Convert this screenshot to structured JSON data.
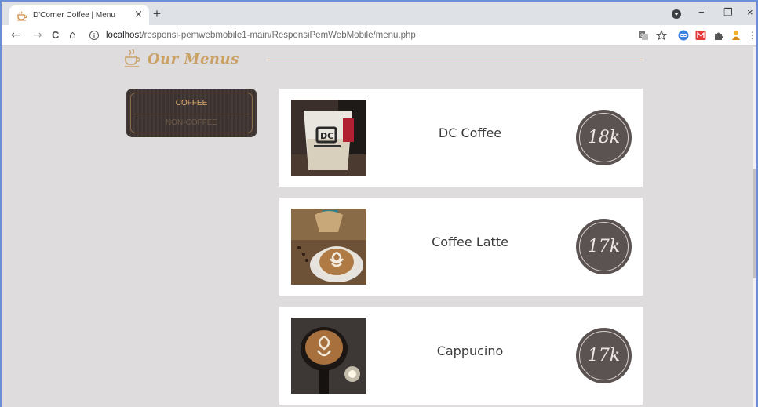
{
  "browser": {
    "tab_title": "D'Corner Coffee | Menu",
    "tab_close": "×",
    "new_tab": "+",
    "url_host": "localhost",
    "url_path": "/responsi-pemwebmobile1-main/ResponsiPemWebMobile/menu.php",
    "window_controls": {
      "minimize": "−",
      "restore": "❐",
      "close": "×"
    },
    "nav": {
      "back": "←",
      "forward": "→",
      "reload": "C",
      "home": "⌂"
    }
  },
  "page": {
    "heading": "Our Menus",
    "categories": [
      {
        "label": "COFFEE",
        "active": true
      },
      {
        "label": "NON-COFFEE",
        "active": false
      }
    ],
    "menu_items": [
      {
        "name": "DC Coffee",
        "price": "18k",
        "image": "dc-coffee-cup-photo"
      },
      {
        "name": "Coffee Latte",
        "price": "17k",
        "image": "coffee-latte-art-photo"
      },
      {
        "name": "Cappucino",
        "price": "17k",
        "image": "cappucino-latte-art-photo"
      }
    ]
  },
  "colors": {
    "accent_gold": "#caa063",
    "badge_brown": "#5b5351",
    "category_bg": "#3f3532",
    "page_bg": "#dedcdc"
  }
}
